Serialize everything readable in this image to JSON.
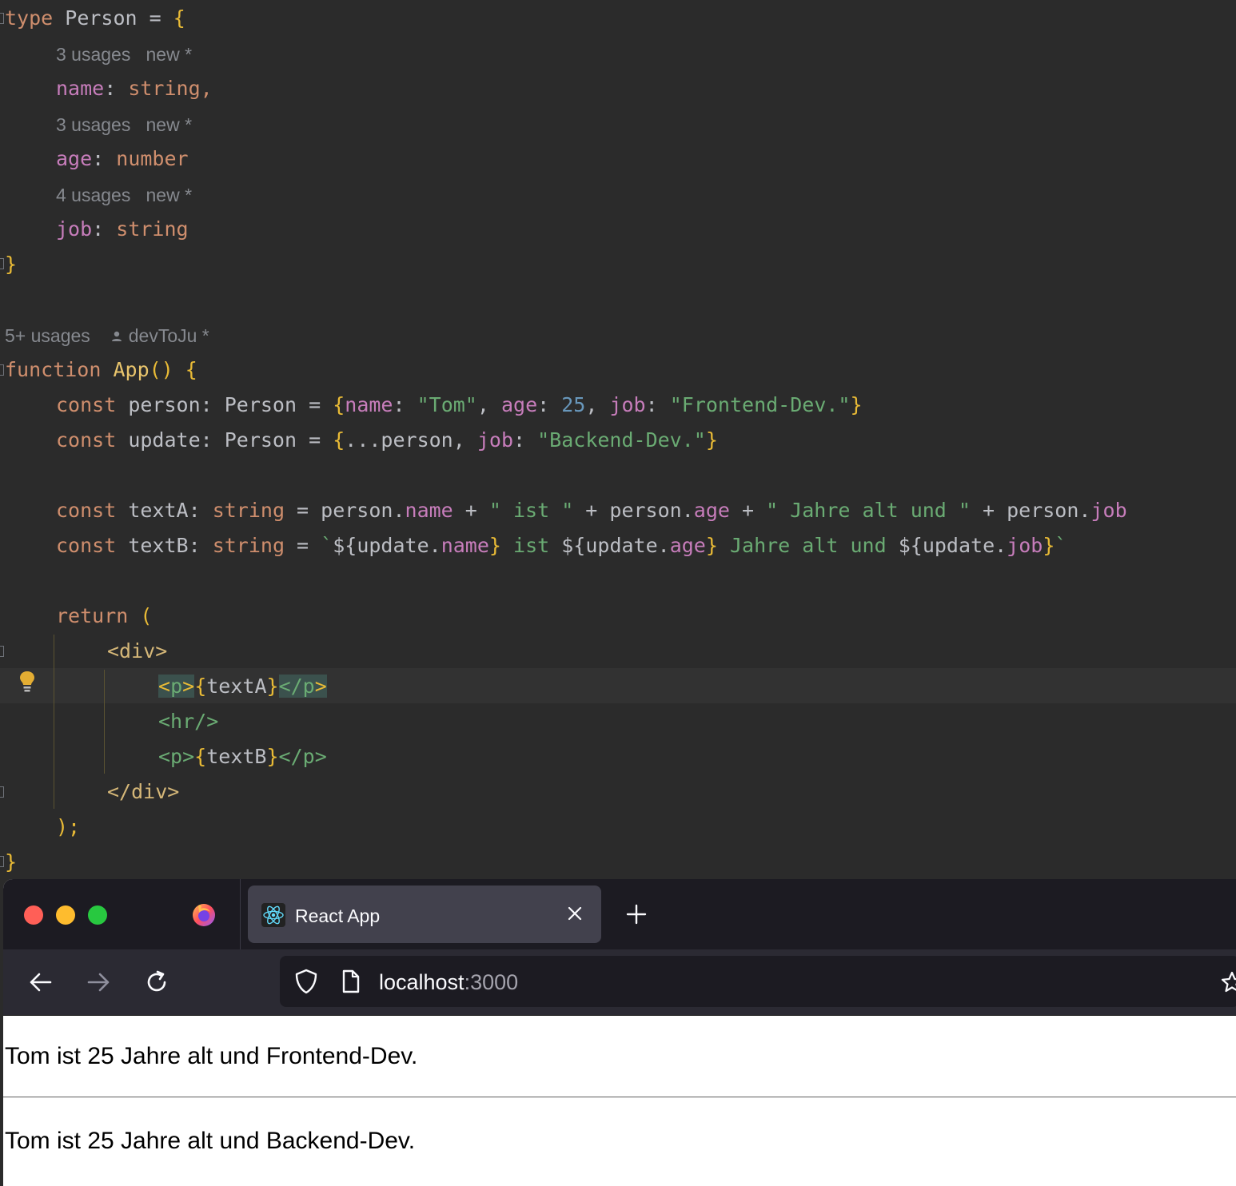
{
  "editor": {
    "hints": {
      "name": "3 usages   new *",
      "age": "3 usages   new *",
      "job": "4 usages   new *",
      "app_usages": "5+ usages",
      "app_author": "devToJu *"
    },
    "type_decl": {
      "kw": "type",
      "name": " Person = ",
      "open": "{"
    },
    "props": [
      {
        "name": "name",
        "type": "string,",
        "colon": ": "
      },
      {
        "name": "age",
        "type": "number",
        "colon": ": "
      },
      {
        "name": "job",
        "type": "string",
        "colon": ": "
      }
    ],
    "close_brace": "}",
    "function_decl": {
      "kw": "function",
      "name": "App",
      "parens": "() ",
      "open": "{"
    }
  },
  "browser": {
    "tab_title": "React App",
    "url_host": "localhost",
    "url_port": ":3000",
    "text_a": "Tom ist 25 Jahre alt und Frontend-Dev.",
    "text_b": "Tom ist 25 Jahre alt und Backend-Dev."
  },
  "colors": {
    "editor_bg": "#2b2b2b",
    "keyword": "#cf8e6d",
    "property": "#c77dbb",
    "string": "#6aab73",
    "number": "#6897bb",
    "bracket": "#e8ba36",
    "traffic_red": "#ff5f57",
    "traffic_yellow": "#febc2e",
    "traffic_green": "#28c840"
  },
  "icons": [
    "lightbulb-icon",
    "firefox-logo-icon",
    "react-icon",
    "close-icon",
    "plus-icon",
    "back-arrow-icon",
    "forward-arrow-icon",
    "reload-icon",
    "shield-icon",
    "page-icon",
    "star-icon"
  ]
}
